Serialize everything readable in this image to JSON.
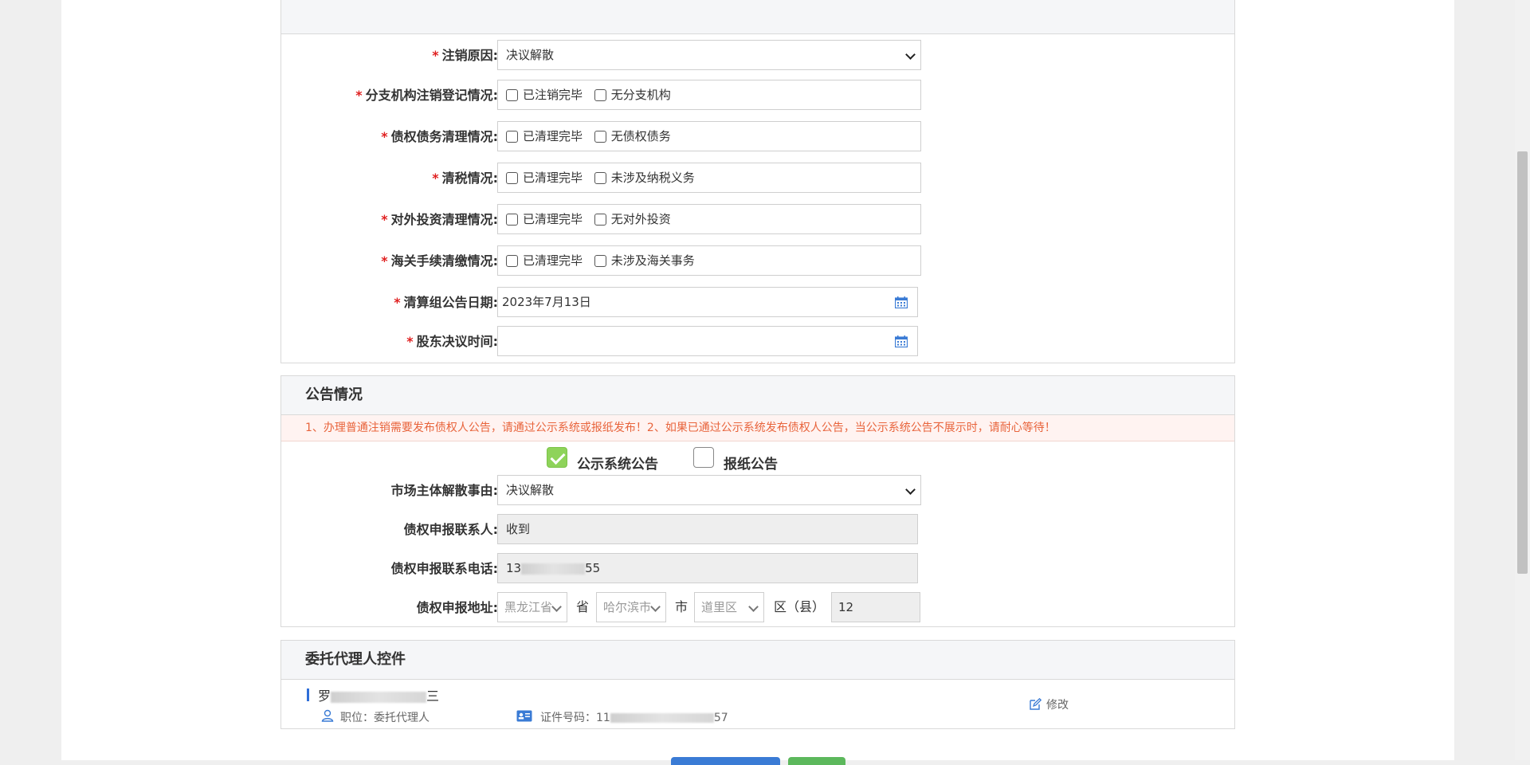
{
  "cancellation": {
    "reason": {
      "label": "注销原因:",
      "value": "决议解散"
    },
    "branch": {
      "label": "分支机构注销登记情况:",
      "options": [
        "已注销完毕",
        "无分支机构"
      ]
    },
    "debt": {
      "label": "债权债务清理情况:",
      "options": [
        "已清理完毕",
        "无债权债务"
      ]
    },
    "tax": {
      "label": "清税情况:",
      "options": [
        "已清理完毕",
        "未涉及纳税义务"
      ]
    },
    "investment": {
      "label": "对外投资清理情况:",
      "options": [
        "已清理完毕",
        "无对外投资"
      ]
    },
    "customs": {
      "label": "海关手续清缴情况:",
      "options": [
        "已清理完毕",
        "未涉及海关事务"
      ]
    },
    "notice_date": {
      "label": "清算组公告日期:",
      "value": "2023年7月13日"
    },
    "resolution_time": {
      "label": "股东决议时间:",
      "value": ""
    }
  },
  "announcement": {
    "title": "公告情况",
    "notice": "1、办理普通注销需要发布债权人公告，请通过公示系统或报纸发布！2、如果已通过公示系统发布债权人公告，当公示系统公告不展示时，请耐心等待！",
    "system_label": "公示系统公告",
    "system_checked": true,
    "newspaper_label": "报纸公告",
    "newspaper_checked": false,
    "dissolution": {
      "label": "市场主体解散事由:",
      "value": "决议解散"
    },
    "contact": {
      "label": "债权申报联系人:",
      "value": "收到"
    },
    "phone": {
      "label": "债权申报联系电话:",
      "prefix": "13",
      "suffix": "55"
    },
    "address": {
      "label": "债权申报地址:",
      "province": "黑龙江省",
      "province_unit": "省",
      "city": "哈尔滨市",
      "city_unit": "市",
      "district": "道里区",
      "district_unit": "区（县）",
      "detail": "12"
    }
  },
  "agent": {
    "title": "委托代理人控件",
    "name_prefix": "罗",
    "name_suffix": "三",
    "position": "职位：委托代理人",
    "id_label": "证件号码：11",
    "id_suffix": "57",
    "edit_label": "修改"
  },
  "colors": {
    "required": "#e02020",
    "notice_text": "#e8643c",
    "checked": "#8ed35a",
    "accent": "#2f6ed8"
  }
}
